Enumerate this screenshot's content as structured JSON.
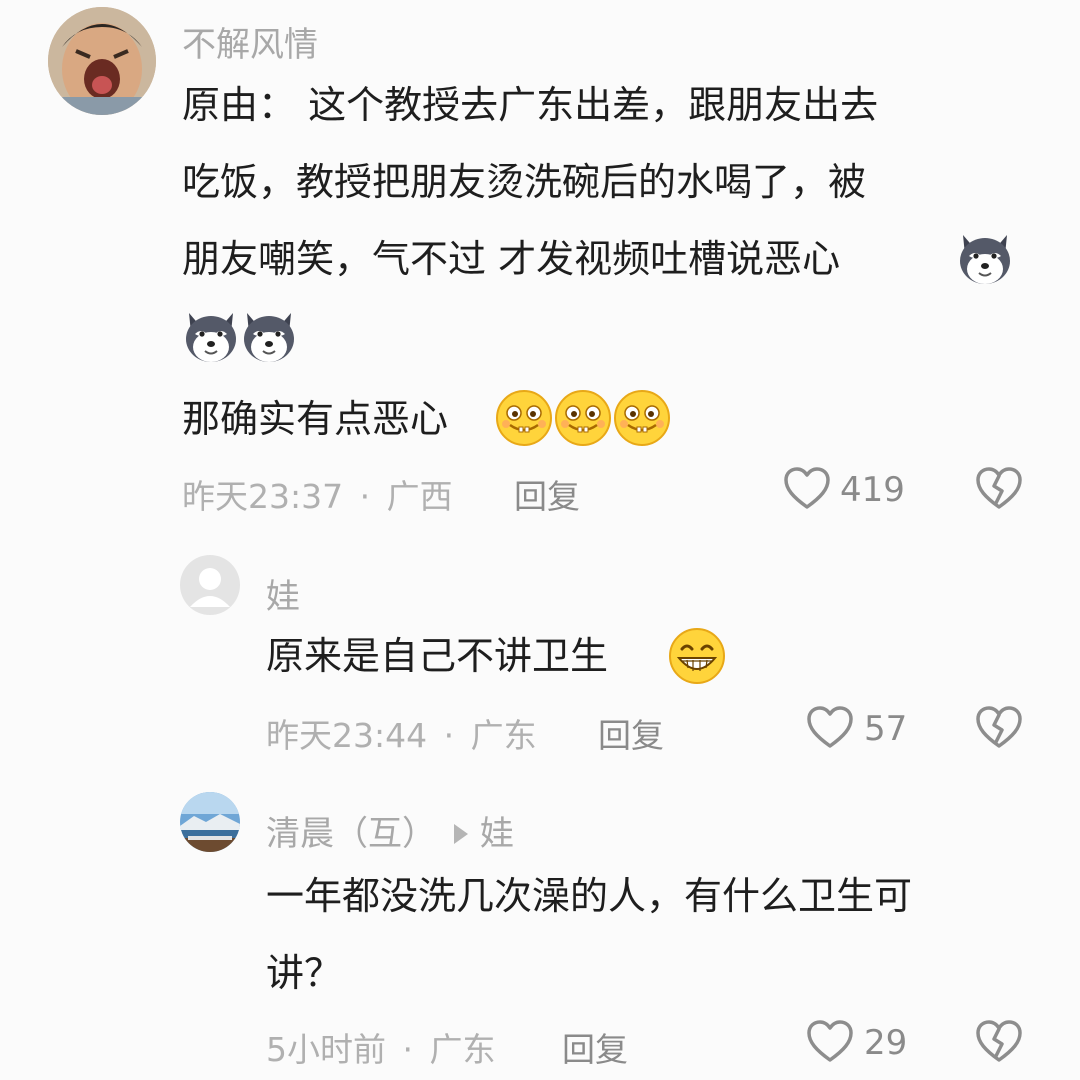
{
  "comments": [
    {
      "author": "不解风情",
      "lines": [
        "原由： 这个教授去广东出差，跟朋友出去",
        "吃饭，教授把朋友烫洗碗后的水喝了，被",
        "朋友嘲笑，气不过 才发视频吐槽说恶心"
      ],
      "line2": "那确实有点恶心",
      "time": "昨天23:37",
      "location": "广西",
      "reply_label": "回复",
      "likes": "419"
    },
    {
      "author": "娃",
      "text": "原来是自己不讲卫生",
      "time": "昨天23:44",
      "location": "广东",
      "reply_label": "回复",
      "likes": "57"
    },
    {
      "author": "清晨（互）",
      "reply_to": "娃",
      "lines": [
        "一年都没洗几次澡的人，有什么卫生可",
        "讲？"
      ],
      "time": "5小时前",
      "location": "广东",
      "reply_label": "回复",
      "likes": "29"
    }
  ],
  "meta_separator": "·",
  "icons": [
    "heart-outline-icon",
    "broken-heart-icon",
    "husky-emoji-icon",
    "giggle-emoji-icon",
    "grin-emoji-icon",
    "user-placeholder-icon"
  ]
}
